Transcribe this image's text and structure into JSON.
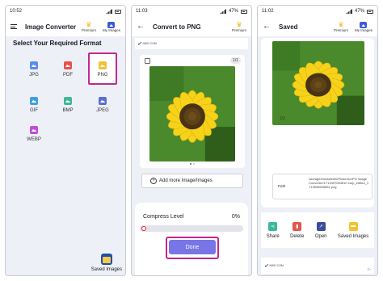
{
  "screen1": {
    "status": {
      "time": "10:52",
      "battery": ""
    },
    "title": "Image Converter",
    "premium_label": "Premium",
    "my_images_label": "My Images",
    "heading": "Select Your Required Format",
    "formats": [
      {
        "label": "JPG",
        "color": "#5b8def"
      },
      {
        "label": "PDF",
        "color": "#e5534b"
      },
      {
        "label": "PNG",
        "color": "#f2c230"
      },
      {
        "label": "GIF",
        "color": "#3fa0e0"
      },
      {
        "label": "BMP",
        "color": "#3bb89a"
      },
      {
        "label": "JPEG",
        "color": "#5a6fd6"
      },
      {
        "label": "WEBP",
        "color": "#c04fd8"
      }
    ],
    "saved_images_label": "Saved Images"
  },
  "screen2": {
    "status": {
      "time": "11:03",
      "battery": "47%"
    },
    "title": "Convert to PNG",
    "premium_label": "Premium",
    "ad_brand": "NIKE.COM",
    "image_counter": "1/1",
    "add_more_label": "Add more Image/Images",
    "compress_label": "Compress Level",
    "compress_value": "0%",
    "done_label": "Done"
  },
  "screen3": {
    "status": {
      "time": "11:02",
      "battery": "47%"
    },
    "title": "Saved",
    "premium_label": "Premium",
    "my_images_label": "My Images",
    "image_counter": "1/2",
    "path_label": "Path",
    "path_value": "/storage/emulated/0/Pictures/JPG Image Converter/1713497064510 crop_edited_1713505605851.png",
    "actions": [
      {
        "label": "Share",
        "color": "#3bb89a",
        "icon": "share-icon"
      },
      {
        "label": "Delete",
        "color": "#e5534b",
        "icon": "delete-icon"
      },
      {
        "label": "Open",
        "color": "#3a4c9a",
        "icon": "open-icon"
      },
      {
        "label": "Saved Images",
        "color": "#f2c230",
        "icon": "folder-icon"
      }
    ],
    "ad_brand": "NIKE.COM"
  },
  "colors": {
    "highlight": "#c2298f",
    "done_button": "#7876e6"
  }
}
